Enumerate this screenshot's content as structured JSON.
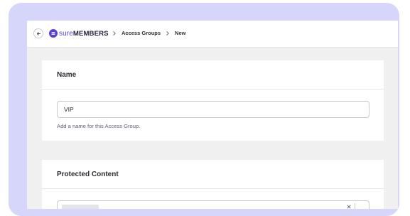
{
  "header": {
    "logo": {
      "sure": "sure",
      "members": "MEMBERS"
    },
    "breadcrumb": {
      "items": [
        {
          "label": "Access Groups"
        },
        {
          "label": "New"
        }
      ]
    }
  },
  "name_card": {
    "title": "Name",
    "input_value": "VIP",
    "help_text": "Add a name for this Access Group."
  },
  "content_card": {
    "title": "Protected Content"
  },
  "colors": {
    "brand": "#5b3fd1",
    "frame": "#d6d6fb",
    "background": "#f0f0f1"
  }
}
